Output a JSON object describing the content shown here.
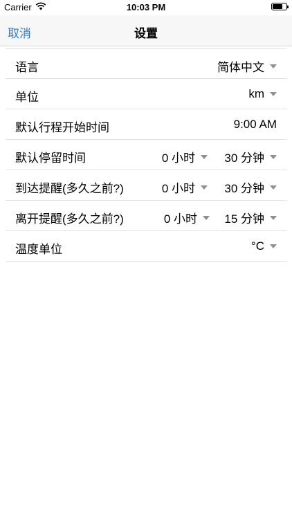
{
  "status": {
    "carrier": "Carrier",
    "time": "10:03 PM",
    "battery_level": 0.75
  },
  "nav": {
    "cancel_label": "取消",
    "title": "设置"
  },
  "settings": {
    "language": {
      "label": "语言",
      "value": "简体中文"
    },
    "unit": {
      "label": "单位",
      "value": "km"
    },
    "trip_start": {
      "label": "默认行程开始时间",
      "value": "9:00 AM"
    },
    "stay_duration": {
      "label": "默认停留时间",
      "hours": "0 小时",
      "minutes": "30 分钟"
    },
    "arrival_reminder": {
      "label": "到达提醒(多久之前?)",
      "hours": "0 小时",
      "minutes": "30 分钟"
    },
    "departure_reminder": {
      "label": "离开提醒(多久之前?)",
      "hours": "0 小时",
      "minutes": "15 分钟"
    },
    "temperature_unit": {
      "label": "温度单位",
      "value": "°C"
    }
  },
  "colors": {
    "accent": "#2f7dd7",
    "caret": "#8e8e93",
    "separator": "#e3e3e6"
  },
  "icons": {
    "wifi": "wifi-icon",
    "battery": "battery-icon",
    "dropdown": "triangle-down-icon"
  }
}
